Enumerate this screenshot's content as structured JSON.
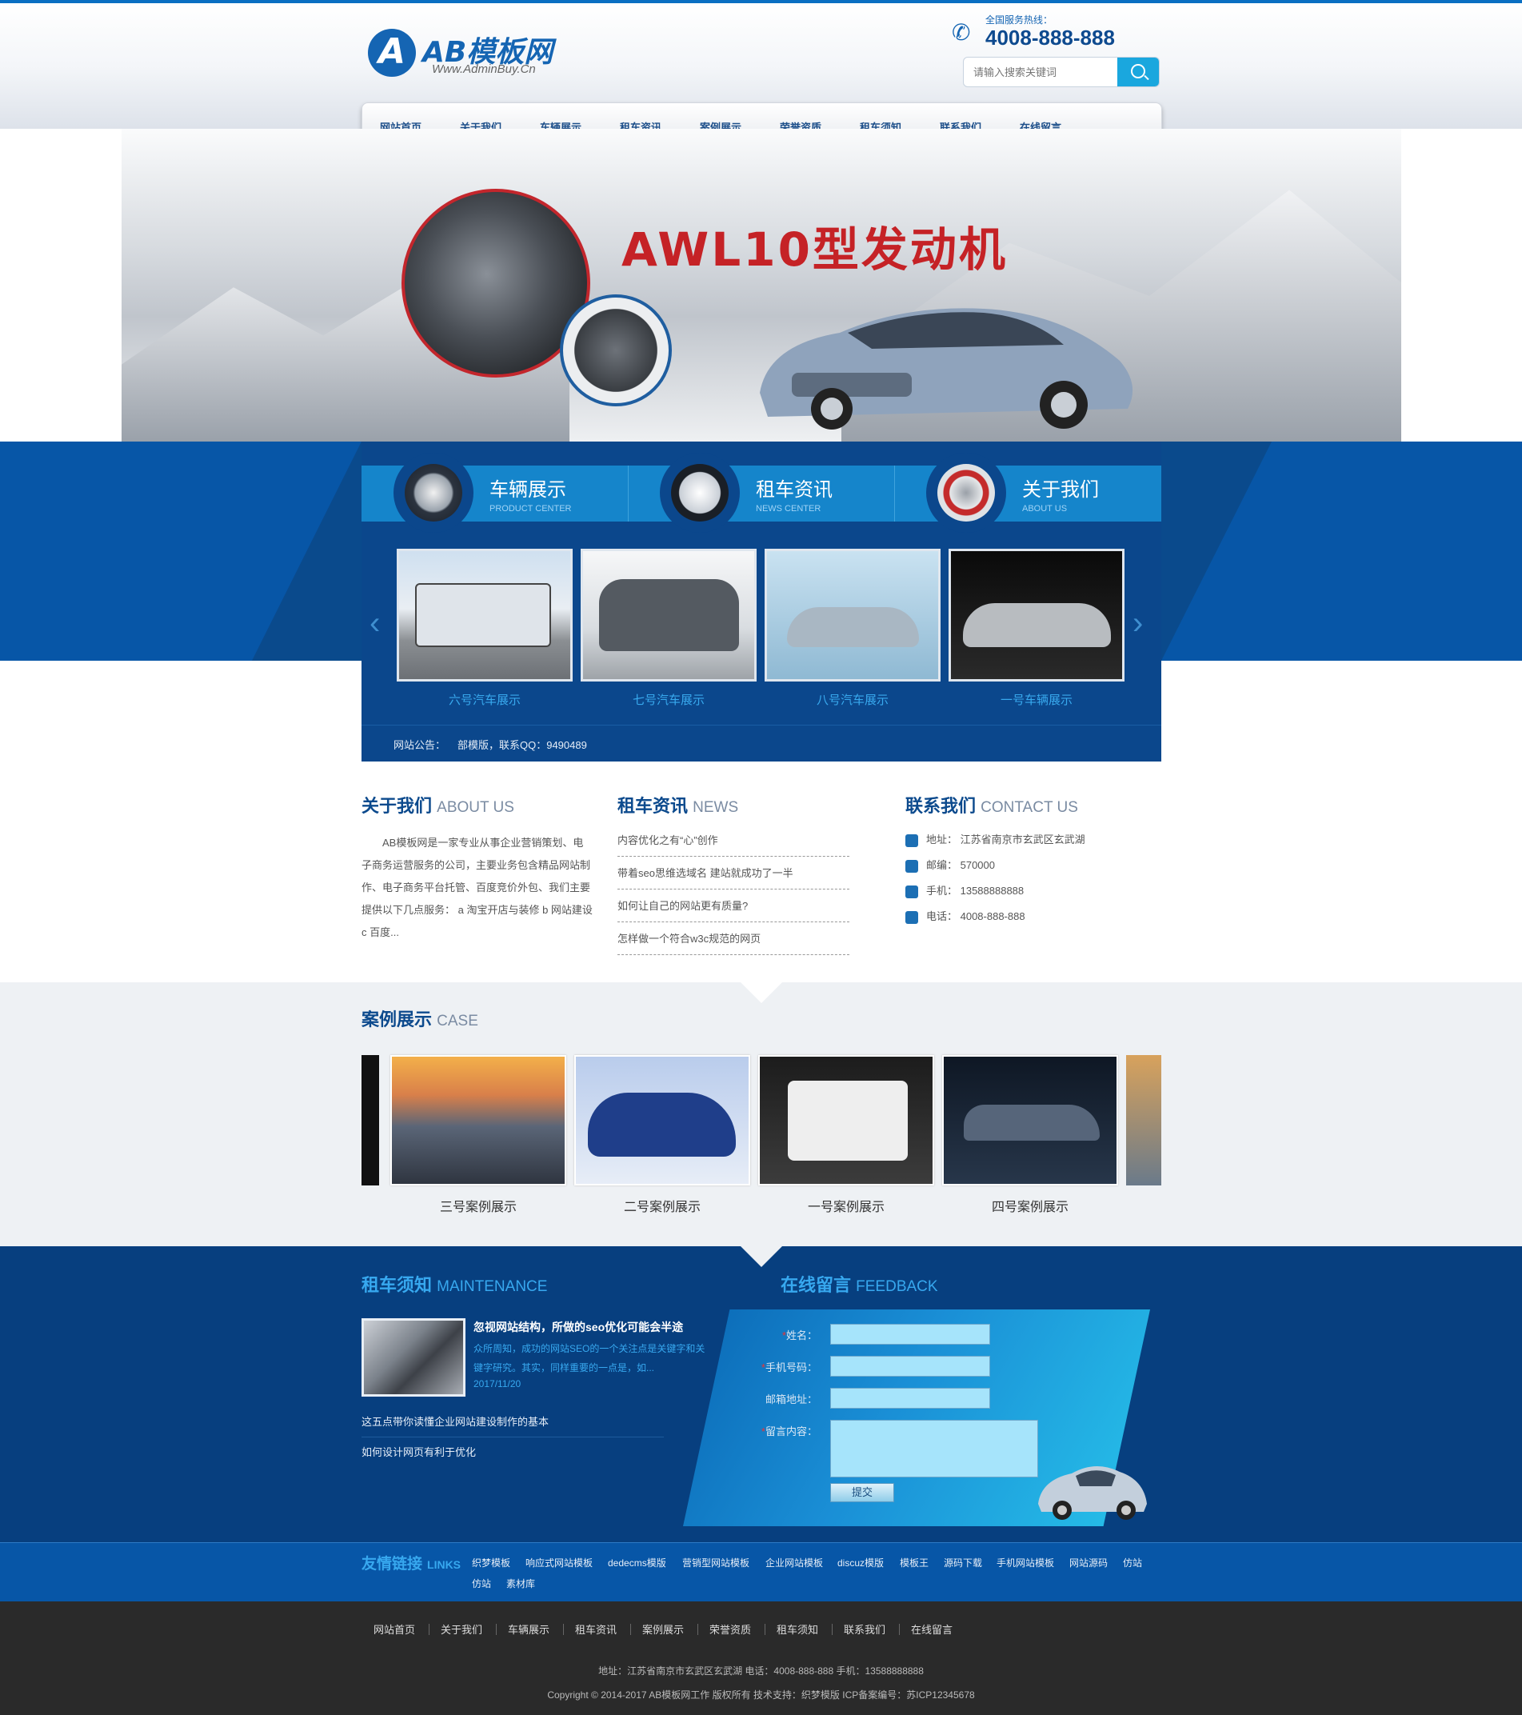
{
  "site": {
    "logo_text": "AB模板网",
    "logo_letter": "A",
    "logo_sub": "Www.AdminBuy.Cn",
    "hotline_label": "全国服务热线：",
    "hotline": "4008-888-888",
    "search_placeholder": "请输入搜索关键词"
  },
  "nav": [
    "网站首页",
    "关于我们",
    "车辆展示",
    "租车资讯",
    "案例展示",
    "荣誉资质",
    "租车须知",
    "联系我们",
    "在线留言"
  ],
  "banner": {
    "title": "AWL10型发动机"
  },
  "product_tabs": [
    {
      "title": "车辆展示",
      "sub": "PRODUCT CENTER"
    },
    {
      "title": "租车资讯",
      "sub": "NEWS CENTER"
    },
    {
      "title": "关于我们",
      "sub": "ABOUT US"
    }
  ],
  "products": [
    "六号汽车展示",
    "七号汽车展示",
    "八号汽车展示",
    "一号车辆展示"
  ],
  "notice": {
    "label": "网站公告：",
    "text": "部模版，联系QQ：9490489"
  },
  "about": {
    "title": "关于我们",
    "title_en": "ABOUT US",
    "text": "AB模板网是一家专业从事企业营销策划、电子商务运营服务的公司，主要业务包含精品网站制作、电子商务平台托管、百度竞价外包、我们主要提供以下几点服务： a 淘宝开店与装修 b 网站建设 c 百度..."
  },
  "news": {
    "title": "租车资讯",
    "title_en": "NEWS",
    "items": [
      "内容优化之有“心”创作",
      "带着seo思维选域名 建站就成功了一半",
      "如何让自己的网站更有质量?",
      "怎样做一个符合w3c规范的网页"
    ]
  },
  "contact": {
    "title": "联系我们",
    "title_en": "CONTACT US",
    "rows": [
      "地址：  江苏省南京市玄武区玄武湖",
      "邮编：  570000",
      "手机：  13588888888",
      "电话：  4008-888-888"
    ]
  },
  "cases": {
    "title": "案例展示",
    "title_en": "CASE",
    "items": [
      "三号案例展示",
      "二号案例展示",
      "一号案例展示",
      "四号案例展示"
    ]
  },
  "maintenance": {
    "title": "租车须知",
    "title_en": "MAINTENANCE",
    "head": "忽视网站结构，所做的seo优化可能会半途",
    "desc": "众所周知，成功的网站SEO的一个关注点是关键字和关键字研究。其实，同样重要的一点是，如...",
    "date": "2017/11/20",
    "links": [
      "这五点带你读懂企业网站建设制作的基本",
      "如何设计网页有利于优化"
    ]
  },
  "feedback": {
    "title": "在线留言",
    "title_en": "FEEDBACK",
    "fields": [
      "姓名：",
      "手机号码：",
      "邮箱地址：",
      "留言内容："
    ],
    "required": "*",
    "submit": "提交"
  },
  "links": {
    "title": "友情链接",
    "title_en": "LINKS",
    "items": [
      "织梦模板",
      "响应式网站模板",
      "dedecms模版",
      "营销型网站模板",
      "企业网站模板",
      "discuz模版",
      "模板王",
      "源码下载",
      "手机网站模板",
      "网站源码",
      "仿站",
      "仿站",
      "素材库"
    ]
  },
  "footer": {
    "nav": [
      "网站首页",
      "关于我们",
      "车辆展示",
      "租车资讯",
      "案例展示",
      "荣誉资质",
      "租车须知",
      "联系我们",
      "在线留言"
    ],
    "address": "地址：江苏省南京市玄武区玄武湖   电话：4008-888-888   手机：13588888888",
    "copyright": "Copyright © 2014-2017 AB模板网工作 版权所有   技术支持：织梦模版   ICP备案编号：苏ICP12345678"
  },
  "colors": {
    "brand": "#0756a7",
    "accent": "#37a8ef",
    "banner_title": "#c52226"
  }
}
